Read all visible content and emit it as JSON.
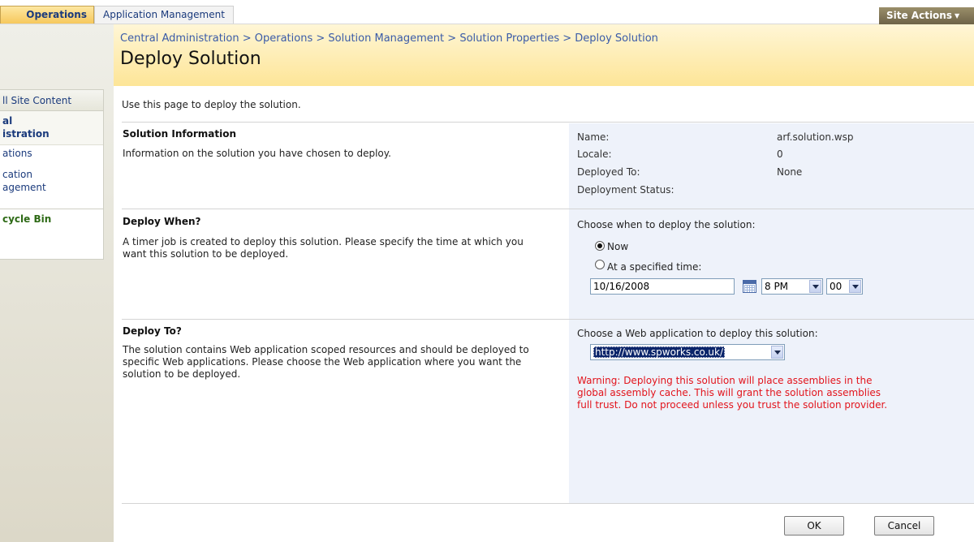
{
  "top_nav": {
    "tabs": [
      {
        "label": "Operations"
      },
      {
        "label": "Application Management"
      }
    ],
    "site_actions": "Site Actions"
  },
  "header": {
    "breadcrumb": [
      "Central Administration",
      "Operations",
      "Solution Management",
      "Solution Properties",
      "Deploy Solution"
    ],
    "separator": " > ",
    "title": "Deploy Solution"
  },
  "left_nav": {
    "all_site_content": "ll Site Content",
    "central_admin": [
      "al",
      "istration"
    ],
    "operations": "ations",
    "app_management": [
      "cation",
      "agement"
    ],
    "recycle_bin": "cycle Bin"
  },
  "main": {
    "intro": "Use this page to deploy the solution.",
    "solution_info": {
      "title": "Solution Information",
      "description": "Information on the solution you have chosen to deploy.",
      "fields": [
        {
          "label": "Name:",
          "value": "arf.solution.wsp"
        },
        {
          "label": "Locale:",
          "value": "0"
        },
        {
          "label": "Deployed To:",
          "value": "None"
        },
        {
          "label": "Deployment Status:",
          "value": ""
        }
      ]
    },
    "deploy_when": {
      "title": "Deploy When?",
      "description": "A timer job is created to deploy this solution. Please specify the time at which you want this solution to be deployed.",
      "prompt": "Choose when to deploy the solution:",
      "option_now": "Now",
      "option_specified": "At a specified time:",
      "selected": "now",
      "date_value": "10/16/2008",
      "hour_value": "8 PM",
      "minute_value": "00"
    },
    "deploy_to": {
      "title": "Deploy To?",
      "description": "The solution contains Web application scoped resources and should be deployed to specific Web applications. Please choose the Web application where you want the solution to be deployed.",
      "prompt": "Choose a Web application to deploy this solution:",
      "web_app_value": "http://www.spworks.co.uk/",
      "warning": "Warning: Deploying this solution will place assemblies in the global assembly cache. This will grant the solution assemblies full trust. Do not proceed unless you trust the solution provider."
    },
    "buttons": {
      "ok": "OK",
      "cancel": "Cancel"
    }
  },
  "colors": {
    "header_gradient_top": "#fff6d6",
    "header_gradient_bottom": "#fde597",
    "link_blue": "#3a5ba8",
    "warning_red": "#e2141c",
    "panel_bg": "#eef2fa"
  }
}
